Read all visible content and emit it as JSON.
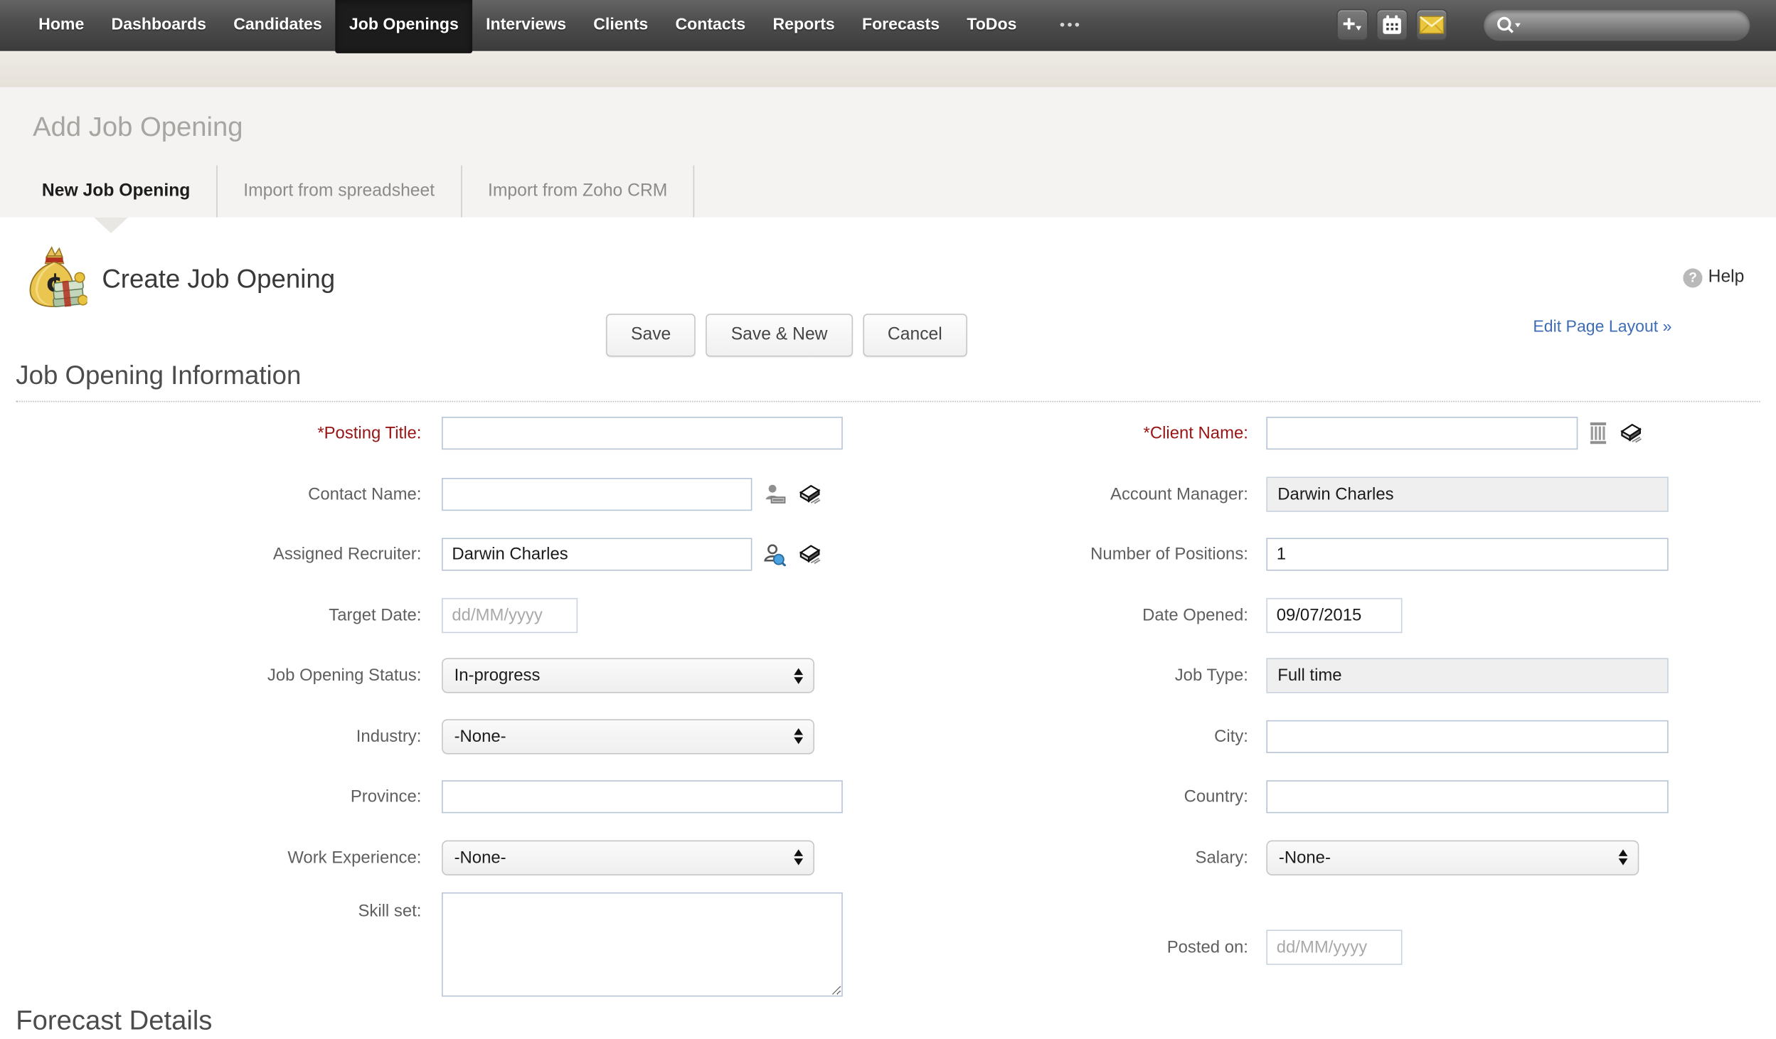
{
  "nav": {
    "items": [
      {
        "label": "Home"
      },
      {
        "label": "Dashboards"
      },
      {
        "label": "Candidates"
      },
      {
        "label": "Job Openings",
        "active": true
      },
      {
        "label": "Interviews"
      },
      {
        "label": "Clients"
      },
      {
        "label": "Contacts"
      },
      {
        "label": "Reports"
      },
      {
        "label": "Forecasts"
      },
      {
        "label": "ToDos"
      }
    ],
    "overflow_label": "•••",
    "actions": {
      "add_icon": "plus-with-caret",
      "calendar_icon": "calendar",
      "mail_icon": "yellow-envelope",
      "search_placeholder": ""
    }
  },
  "header": {
    "page_title": "Add Job Opening",
    "tabs": [
      {
        "label": "New Job Opening",
        "active": true
      },
      {
        "label": "Import from spreadsheet",
        "active": false
      },
      {
        "label": "Import from Zoho CRM",
        "active": false
      }
    ]
  },
  "record": {
    "icon": "money-bag-icon",
    "title": "Create Job Opening",
    "help_label": "Help",
    "help_icon_glyph": "?"
  },
  "toolbar": {
    "save_label": "Save",
    "save_new_label": "Save & New",
    "cancel_label": "Cancel",
    "edit_layout_label": "Edit Page Layout »"
  },
  "section": {
    "title": "Job Opening Information"
  },
  "next_section": {
    "title": "Forecast Details"
  },
  "form": {
    "left": [
      {
        "mark": "*",
        "label": "Posting Title:",
        "type": "text",
        "value": ""
      },
      {
        "mark": "",
        "label": "Contact Name:",
        "type": "text",
        "value": "",
        "icons": [
          "contact-lookup-icon",
          "clear-icon"
        ]
      },
      {
        "mark": "",
        "label": "Assigned Recruiter:",
        "type": "text",
        "value": "Darwin Charles",
        "icons": [
          "recruiter-lookup-icon",
          "clear-icon"
        ]
      },
      {
        "mark": "",
        "label": "Target Date:",
        "type": "date",
        "value": "",
        "placeholder": "dd/MM/yyyy"
      },
      {
        "mark": "",
        "label": "Job Opening Status:",
        "type": "select",
        "value": "In-progress"
      },
      {
        "mark": "",
        "label": "Industry:",
        "type": "select",
        "value": "-None-"
      },
      {
        "mark": "",
        "label": "Province:",
        "type": "text",
        "value": ""
      },
      {
        "mark": "",
        "label": "Work Experience:",
        "type": "select",
        "value": "-None-"
      },
      {
        "mark": "",
        "label": "Skill set:",
        "type": "textarea",
        "value": ""
      }
    ],
    "right": [
      {
        "mark": "*",
        "label": "Client Name:",
        "type": "text",
        "value": "",
        "icons": [
          "client-lookup-icon",
          "clear-icon"
        ]
      },
      {
        "mark": "",
        "label": "Account Manager:",
        "type": "readonly",
        "value": "Darwin Charles"
      },
      {
        "mark": "",
        "label": "Number of Positions:",
        "type": "text",
        "value": "1"
      },
      {
        "mark": "",
        "label": "Date Opened:",
        "type": "date",
        "value": "09/07/2015"
      },
      {
        "mark": "",
        "label": "Job Type:",
        "type": "readonly",
        "value": "Full time"
      },
      {
        "mark": "",
        "label": "City:",
        "type": "text",
        "value": ""
      },
      {
        "mark": "",
        "label": "Country:",
        "type": "text",
        "value": ""
      },
      {
        "mark": "",
        "label": "Salary:",
        "type": "select",
        "value": "-None-"
      },
      {
        "mark": "",
        "label": "Posted on:",
        "type": "date",
        "value": "",
        "placeholder": "dd/MM/yyyy"
      }
    ]
  },
  "colors": {
    "nav_active_bg": "#1c1c1c",
    "required_label": "#991515",
    "link_blue": "#3e6db5",
    "envelope_yellow": "#e9c63e",
    "input_border": "#b6c4d6",
    "header_gray": "#f4f3f1"
  }
}
